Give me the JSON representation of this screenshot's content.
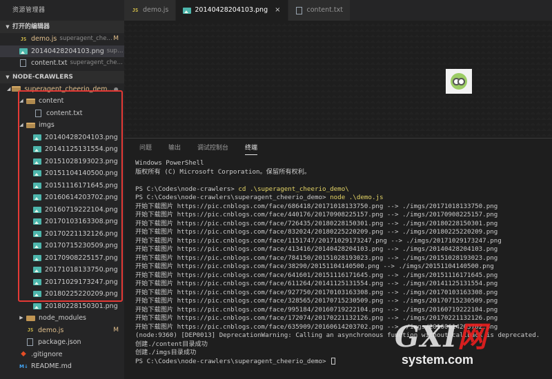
{
  "sidebar": {
    "title": "资源管理器",
    "open_editors": {
      "label": "打开的编辑器",
      "items": [
        {
          "name": "demo.js",
          "desc": "superagent_cheerio...",
          "status": "M",
          "icon": "js-icon"
        },
        {
          "name": "20140428204103.png",
          "desc": "superage...",
          "icon": "image-icon"
        },
        {
          "name": "content.txt",
          "desc": "superagent_cheerio...",
          "icon": "text-file-icon"
        }
      ]
    },
    "project": {
      "label": "NODE-CRAWLERS",
      "root_folder": "superagent_cheerio_dem...",
      "content_folder": "content",
      "content_file": "content.txt",
      "imgs_folder": "imgs",
      "images": [
        "20140428204103.png",
        "20141125131554.png",
        "20151028193023.png",
        "20151104140500.png",
        "20151116171645.png",
        "20160614203702.png",
        "20160719222104.png",
        "20170103163308.png",
        "20170221132126.png",
        "20170715230509.png",
        "20170908225157.png",
        "20171018133750.png",
        "20171029173247.png",
        "20180225220209.png",
        "20180228150301.png"
      ],
      "node_modules": "node_modules",
      "demo_js": "demo.js",
      "demo_js_status": "M",
      "package_json": "package.json",
      "gitignore": ".gitignore",
      "readme": "README.md"
    }
  },
  "tabs": [
    {
      "label": "demo.js",
      "icon": "js-icon"
    },
    {
      "label": "20140428204103.png",
      "icon": "image-icon",
      "close": "×"
    },
    {
      "label": "content.txt",
      "icon": "text-file-icon"
    }
  ],
  "panel": {
    "tabs": [
      "问题",
      "输出",
      "调试控制台",
      "终端"
    ],
    "active_tab": "终端",
    "terminal": {
      "header": [
        "Windows PowerShell",
        "版权所有 (C) Microsoft Corporation。保留所有权利。",
        ""
      ],
      "prompt1": "PS C:\\Codes\\node-crawlers> ",
      "cmd1": "cd .\\superagent_cheerio_demo\\",
      "prompt2": "PS C:\\Codes\\node-crawlers\\superagent_cheerio_demo> ",
      "cmd2": "node .\\demo.js",
      "downloads": [
        "开始下载图片 https://pic.cnblogs.com/face/686418/20171018133750.png --> ./imgs/20171018133750.png",
        "开始下载图片 https://pic.cnblogs.com/face/440176/20170908225157.png --> ./imgs/20170908225157.png",
        "开始下载图片 https://pic.cnblogs.com/face/726435/20180228150301.png --> ./imgs/20180228150301.png",
        "开始下载图片 https://pic.cnblogs.com/face/832024/20180225220209.png --> ./imgs/20180225220209.png",
        "开始下载图片 https://pic.cnblogs.com/face/1151747/20171029173247.png --> ./imgs/20171029173247.png",
        "开始下载图片 https://pic.cnblogs.com/face/413416/20140428204103.png --> ./imgs/20140428204103.png",
        "开始下载图片 https://pic.cnblogs.com/face/784150/20151028193023.png --> ./imgs/20151028193023.png",
        "开始下载图片 https://pic.cnblogs.com/face/38290/20151104140500.png --> ./imgs/20151104140500.png",
        "开始下载图片 https://pic.cnblogs.com/face/641601/20151116171645.png --> ./imgs/20151116171645.png",
        "开始下载图片 https://pic.cnblogs.com/face/611264/20141125131554.png --> ./imgs/20141125131554.png",
        "开始下载图片 https://pic.cnblogs.com/face/927750/20170103163308.png --> ./imgs/20170103163308.png",
        "开始下载图片 https://pic.cnblogs.com/face/328565/20170715230509.png --> ./imgs/20170715230509.png",
        "开始下载图片 https://pic.cnblogs.com/face/995184/20160719222104.png --> ./imgs/20160719222104.png",
        "开始下载图片 https://pic.cnblogs.com/face/172074/20170221132126.png --> ./imgs/20170221132126.png",
        "开始下载图片 https://pic.cnblogs.com/face/635909/20160614203702.png --> ./imgs/20160614203702.png"
      ],
      "warning": "(node:9360) [DEP0013] DeprecationWarning: Calling an asynchronous function without callback is deprecated.",
      "created": [
        "创建./content目录成功",
        "创建./imgs目录成功"
      ],
      "prompt3": "PS C:\\Codes\\node-crawlers\\superagent_cheerio_demo> "
    }
  },
  "watermark": {
    "top": "GXI网",
    "bottom": "system.com"
  }
}
